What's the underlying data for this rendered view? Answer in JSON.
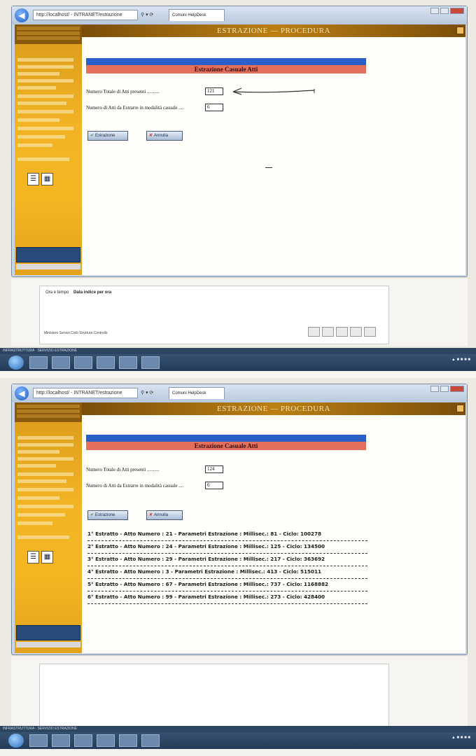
{
  "shared": {
    "address": "http://localhost/ - INTRANET/estrazione",
    "tab": "Comuni HelpDesk",
    "header_title": "ESTRAZIONE — PROCEDURA",
    "section_title": "Estrazione Casuale Atti",
    "label_total": "Numero Totale di Atti presenti ..........",
    "label_extract": "Numero di Atti da Estrarre in modalità casuale ....",
    "btn_extract": "Estrazione",
    "btn_cancel": "Annulla"
  },
  "screen1": {
    "total_atti": "121",
    "atti_da_estrarre": "6",
    "below_label": "Ora e tempo",
    "below_text": "Data indice per ora",
    "below_footer": "Ministero Servizi Civili Struttura Controllo",
    "taskbar_text": "INFRASTRUTTURA · SERVIZIO ESTRAZIONE"
  },
  "screen2": {
    "total_atti": "124",
    "atti_da_estrarre": "6",
    "results": [
      "1° Estratto - Atto Numero : 21 - Parametri Estrazione : Millisec.: 81 - Ciclo: 100278",
      "2° Estratto - Atto Numero : 24 - Parametri Estrazione : Millisec.: 125 - Ciclo: 134500",
      "3° Estratto - Atto Numero : 29 - Parametri Estrazione : Millisec.: 217 - Ciclo: 363692",
      "4° Estratto - Atto Numero : 3 - Parametri Estrazione : Millisec.: 413 - Ciclo: 515011",
      "5° Estratto - Atto Numero : 67 - Parametri Estrazione : Millisec.: 737 - Ciclo: 1168882",
      "6° Estratto - Atto Numero : 99 - Parametri Estrazione : Millisec.: 273 - Ciclo: 428400"
    ],
    "taskbar_text": "INFRASTRUTTURA · SERVIZIO ESTRAZIONE"
  },
  "colors": {
    "sidebar": "#f2b425",
    "header": "#bb7e12",
    "bar_blue": "#2a5fc8",
    "bar_red": "#e2705c"
  },
  "icons": [
    "back-arrow-icon",
    "check-icon",
    "cancel-x-icon",
    "windows-start-icon"
  ]
}
